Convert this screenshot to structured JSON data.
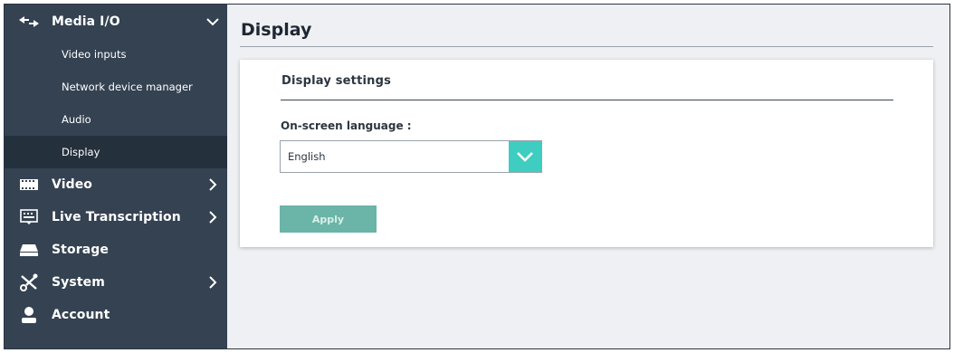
{
  "sidebar": {
    "media_io": {
      "label": "Media I/O",
      "icon": "arrows-icon",
      "expanded": true,
      "items": [
        {
          "label": "Video inputs",
          "active": false
        },
        {
          "label": "Network device manager",
          "active": false
        },
        {
          "label": "Audio",
          "active": false
        },
        {
          "label": "Display",
          "active": true
        }
      ]
    },
    "video": {
      "label": "Video",
      "icon": "film-icon"
    },
    "live_transcription": {
      "label": "Live Transcription",
      "icon": "keyboard-icon"
    },
    "storage": {
      "label": "Storage",
      "icon": "drive-icon"
    },
    "system": {
      "label": "System",
      "icon": "tools-icon"
    },
    "account": {
      "label": "Account",
      "icon": "user-icon"
    }
  },
  "main": {
    "title": "Display",
    "card": {
      "heading": "Display settings",
      "language_label": "On-screen language :",
      "language_value": "English",
      "apply_label": "Apply"
    }
  },
  "colors": {
    "sidebar_bg": "#344252",
    "sidebar_active": "#25303d",
    "accent": "#3ecdc0",
    "apply_btn": "#6ab5a7",
    "main_bg": "#eef0f3"
  }
}
